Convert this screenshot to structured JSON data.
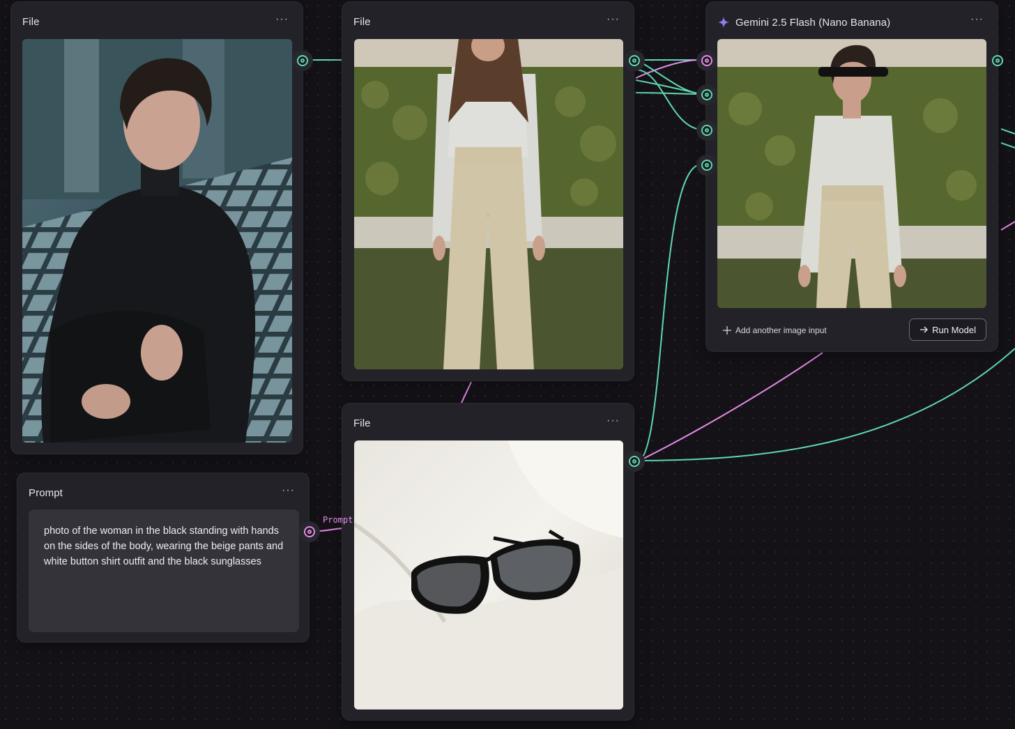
{
  "nodes": {
    "file1": {
      "title": "File",
      "menu": "···"
    },
    "file2": {
      "title": "File",
      "menu": "···"
    },
    "file3": {
      "title": "File",
      "menu": "···"
    },
    "gemini": {
      "title": "Gemini 2.5 Flash (Nano Banana)",
      "menu": "···",
      "add_input_label": "Add another image input",
      "run_label": "Run Model"
    },
    "prompt": {
      "title": "Prompt",
      "menu": "···",
      "text": "photo of the woman in the black standing with hands on the sides of the body, wearing the beige pants and white button shirt outfit and the black sunglasses",
      "output_label": "Prompt"
    }
  },
  "images": {
    "file1": "woman with short dark hair in black turtleneck sitting in window light",
    "file2": "woman in white button shirt and beige wide-leg pants in front of hedge",
    "file3": "black sunglasses on white fabric",
    "gemini_output": "woman with short dark hair wearing sunglasses, white shirt and beige pants"
  },
  "colors": {
    "image_wire": "#5fd9b0",
    "text_wire": "#e58be9",
    "canvas_bg": "#141217",
    "node_bg": "#232229"
  },
  "icons": {
    "menu": "ellipsis-icon",
    "model": "sparkle-icon",
    "add": "plus-icon",
    "run": "arrow-right-icon"
  }
}
